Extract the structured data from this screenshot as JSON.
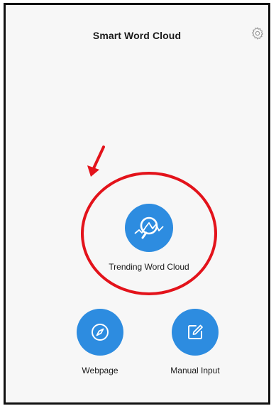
{
  "header": {
    "title": "Smart Word Cloud",
    "settings_icon": "gear-icon"
  },
  "features": {
    "trending": {
      "label": "Trending Word Cloud",
      "icon": "search-chart-icon"
    },
    "webpage": {
      "label": "Webpage",
      "icon": "compass-icon"
    },
    "manual": {
      "label": "Manual Input",
      "icon": "edit-icon"
    }
  },
  "colors": {
    "accent": "#2d8ce0",
    "annotation": "#e3131b",
    "background": "#f7f7f7",
    "text": "#1a1a1a"
  }
}
